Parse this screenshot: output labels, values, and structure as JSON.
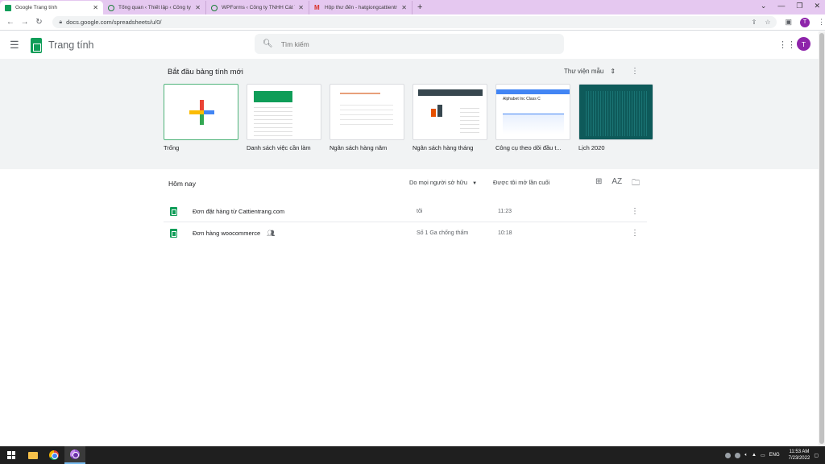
{
  "browser": {
    "tabs": [
      {
        "label": "Google Trang tính",
        "icon": "sheets-icon",
        "active": true
      },
      {
        "label": "Tổng quan ‹ Thiết lập ‹ Công ty T",
        "icon": "wordpress-icon",
        "active": false
      },
      {
        "label": "WPForms ‹ Công ty TNHH Cát Tr",
        "icon": "wordpress-icon",
        "active": false
      },
      {
        "label": "Hộp thư đến - hatgiongcattientr",
        "icon": "gmail-icon",
        "active": false
      }
    ],
    "url": "docs.google.com/spreadsheets/u/0/",
    "profile_initial": "T"
  },
  "app": {
    "title": "Trang tính",
    "search_placeholder": "Tìm kiếm",
    "avatar_initial": "T",
    "accent": "#0f9d58"
  },
  "gallery": {
    "title": "Bắt đầu bảng tính mới",
    "library_label": "Thư viện mẫu",
    "templates": [
      {
        "label": "Trống",
        "kind": "blank"
      },
      {
        "label": "Danh sách việc cần làm",
        "kind": "todo"
      },
      {
        "label": "Ngân sách hàng năm",
        "kind": "annual-budget"
      },
      {
        "label": "Ngân sách hàng tháng",
        "kind": "monthly-budget"
      },
      {
        "label": "Công cụ theo dõi đầu t...",
        "kind": "investment",
        "thumb_text": "Alphabet Inc Class C"
      },
      {
        "label": "Lịch 2020",
        "kind": "calendar"
      }
    ]
  },
  "files": {
    "section_title": "Hôm nay",
    "owner_filter": "Do mọi người sở hữu",
    "sort_label": "Được tôi mở lần cuối",
    "rows": [
      {
        "name": "Đơn đặt hàng từ Cattientrang.com",
        "owner": "tôi",
        "time": "11:23",
        "shared": false
      },
      {
        "name": "Đơn hàng woocommerce",
        "owner": "Số 1 Ga chống thấm",
        "time": "10:18",
        "shared": true
      }
    ]
  },
  "taskbar": {
    "lang": "ENG",
    "time": "11:53 AM",
    "date": "7/23/2022"
  }
}
